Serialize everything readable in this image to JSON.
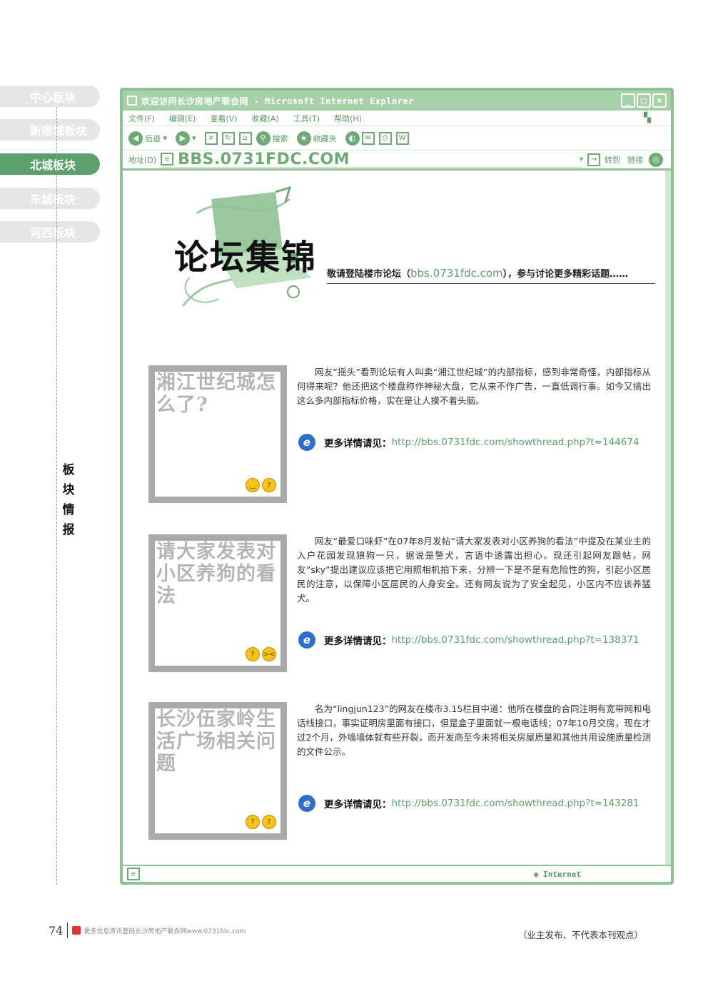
{
  "sidebar": {
    "tabs": [
      {
        "label": "中心板块",
        "active": false
      },
      {
        "label": "新南城板块",
        "active": false
      },
      {
        "label": "北城板块",
        "active": true
      },
      {
        "label": "东城板块",
        "active": false
      },
      {
        "label": "河西板块",
        "active": false
      }
    ],
    "section_label": "板块情报"
  },
  "window": {
    "title": "欢迎访问长沙房地产联合网 - Microsoft Internet Explorer",
    "menu": [
      "文件(F)",
      "编辑(E)",
      "查看(V)",
      "收藏(A)",
      "工具(T)",
      "帮助(H)"
    ],
    "toolbar": {
      "back": "后退",
      "search": "搜索",
      "favorites": "收藏夹"
    },
    "address": {
      "label": "地址(D)",
      "url": "BBS.0731FDC.COM",
      "go": "转到",
      "links": "链接"
    },
    "status": {
      "zone": "Internet"
    }
  },
  "header": {
    "title": "论坛集锦",
    "subtitle_prefix": "敬请登陆楼市论坛（",
    "subtitle_link": "bbs.0731fdc.com",
    "subtitle_suffix": "），参与讨论更多精彩话题……"
  },
  "topics": [
    {
      "title": "湘江世纪城怎么了?",
      "body": "网友“摇头”看到论坛有人叫卖“湘江世纪城”的内部指标，感到非常奇怪，内部指标从何得来呢？他还把这个楼盘称作神秘大盘，它从来不作广告，一直低调行事。如今又搞出这么多内部指标价格，实在是让人摸不着头脑。",
      "more_label": "更多详情请见：",
      "more_url": "http://bbs.0731fdc.com/showthread.php?t=144674"
    },
    {
      "title": "请大家发表对小区养狗的看法",
      "body": "网友“最爱口味虾”在07年8月发帖“请大家发表对小区养狗的看法”中提及在某业主的入户花园发现狼狗一只，据说是警犬，言语中透露出担心。现还引起网友跟帖，网友“sky”提出建议应该把它用照相机拍下来，分辨一下是不是有危险性的狗，引起小区居民的注意，以保障小区居民的人身安全。还有网友说为了安全起见，小区内不应该养猛犬。",
      "more_label": "更多详情请见：",
      "more_url": "http://bbs.0731fdc.com/showthread.php?t=138371"
    },
    {
      "title": "长沙伍家岭生活广场相关问题",
      "body": "名为“lingjun123”的网友在楼市3.15栏目中道：他所在楼盘的合同注明有宽带网和电话线接口，事实证明房里面有接口，但是盒子里面就一根电话线；07年10月交房，现在才过2个月，外墙墙体就有些开裂，而开发商至今未将相关房屋质量和其他共用设施质量检测的文件公示。",
      "more_label": "更多详情请见：",
      "more_url": "http://bbs.0731fdc.com/showthread.php?t=143281"
    }
  ],
  "disclaimer": "（业主发布、不代表本刊观点）",
  "footer": {
    "page_number": "74",
    "text": "更多信息资讯登陆长沙房地产联合网www.0731fdc.com"
  }
}
